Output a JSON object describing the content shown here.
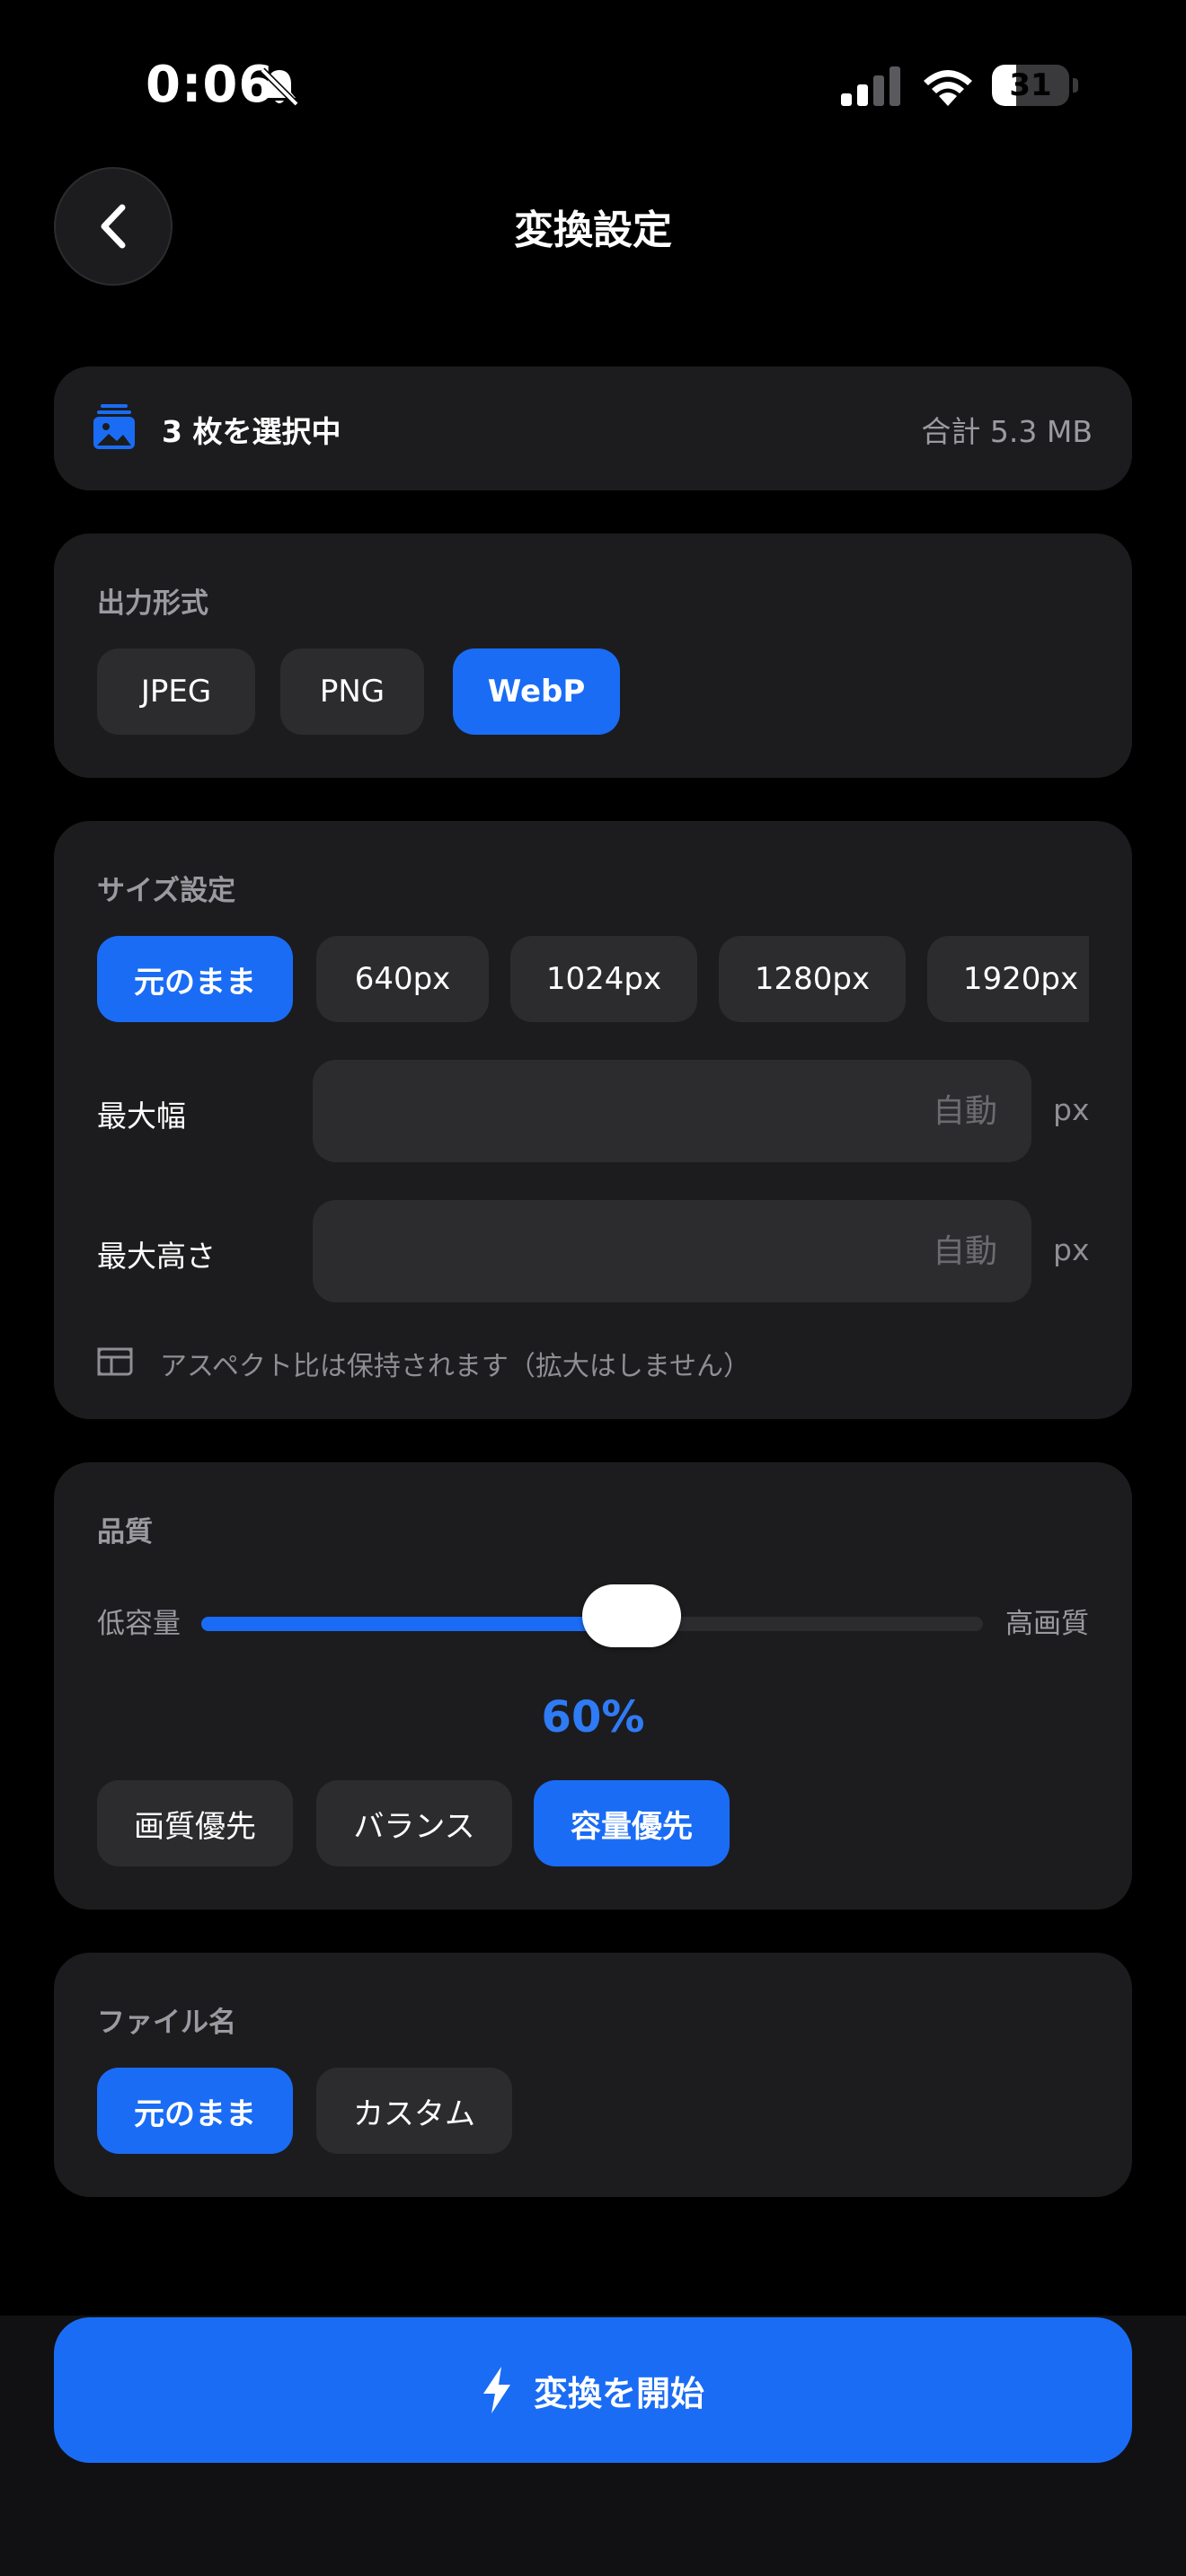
{
  "status": {
    "time": "0:06",
    "battery_level": "31",
    "battery_fraction": 0.31
  },
  "header": {
    "title": "変換設定",
    "back_icon": "chevron-left-icon"
  },
  "selection": {
    "icon": "photo-stack-icon",
    "count_text": "3 枚を選択中",
    "total_text": "合計 5.3 MB"
  },
  "output_format": {
    "label": "出力形式",
    "options": [
      "JPEG",
      "PNG",
      "WebP"
    ],
    "selected": "WebP"
  },
  "size": {
    "label": "サイズ設定",
    "presets": [
      "元のまま",
      "640px",
      "1024px",
      "1280px",
      "1920px"
    ],
    "selected": "元のまま",
    "max_width_label": "最大幅",
    "max_width_placeholder": "自動",
    "max_width_value": "",
    "max_height_label": "最大高さ",
    "max_height_placeholder": "自動",
    "max_height_value": "",
    "unit": "px",
    "note": "アスペクト比は保持されます（拡大はしません）"
  },
  "quality": {
    "label": "品質",
    "min_label": "低容量",
    "max_label": "高画質",
    "value_fraction": 0.55,
    "value_text": "60%",
    "presets": [
      "画質優先",
      "バランス",
      "容量優先"
    ],
    "selected": "容量優先"
  },
  "filename": {
    "label": "ファイル名",
    "options": [
      "元のまま",
      "カスタム"
    ],
    "selected": "元のまま"
  },
  "action": {
    "label": "変換を開始",
    "icon": "bolt-icon"
  },
  "colors": {
    "accent": "#1a6cf5",
    "card": "#1c1c1e",
    "pill": "#2c2c2e",
    "background": "#000000"
  }
}
